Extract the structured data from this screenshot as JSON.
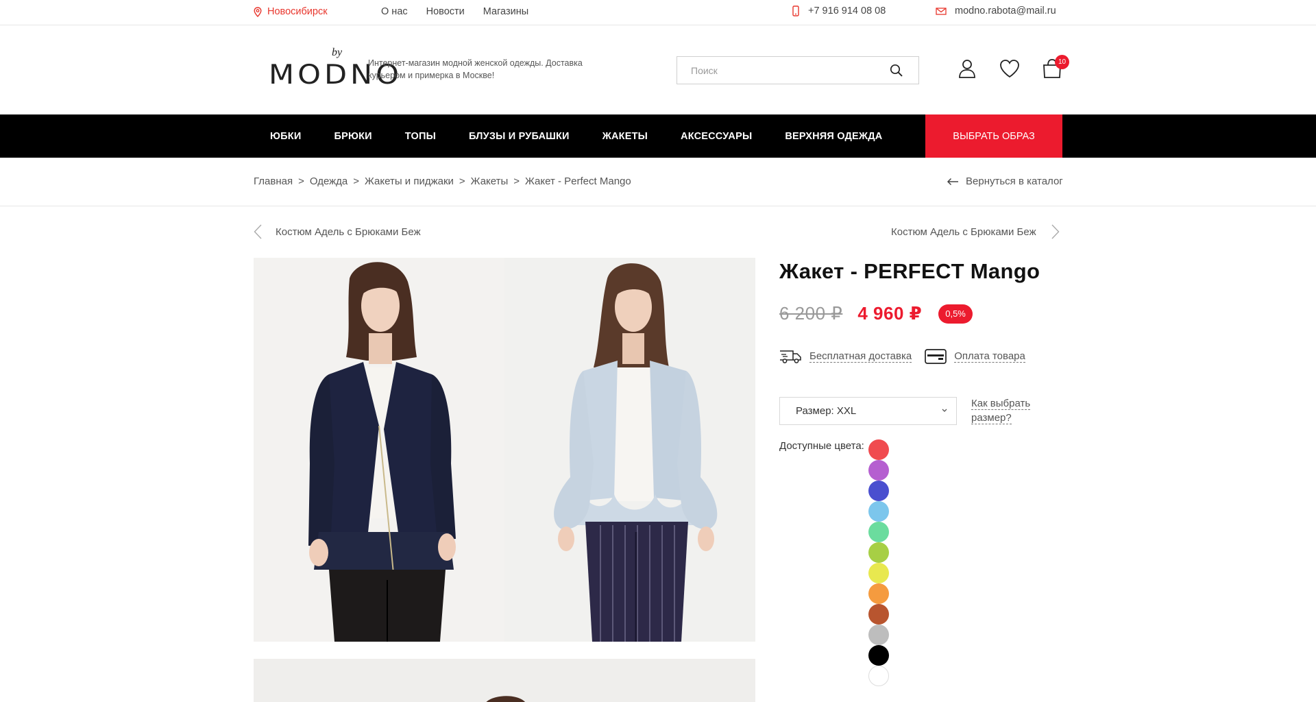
{
  "topbar": {
    "city": "Новосибирск",
    "links": [
      "О нас",
      "Новости",
      "Магазины"
    ],
    "phone": "+7 916 914 08 08",
    "email": "modno.rabota@mail.ru"
  },
  "header": {
    "logo_by": "by",
    "logo_word": "MODNO",
    "tagline": "Интернет-магазин модной женской одежды. Доставка курьером и примерка в Москве!",
    "search_placeholder": "Поиск",
    "cart_count": "10"
  },
  "menu": {
    "items": [
      "Юбки",
      "Брюки",
      "Топы",
      "Блузы и рубашки",
      "Жакеты",
      "Аксессуары",
      "Верхняя одежда"
    ],
    "cta": "Выбрать образ"
  },
  "breadcrumbs": [
    "Главная",
    "Одежда",
    "Жакеты и пиджаки",
    "Жакеты",
    "Жакет - Perfect Mango"
  ],
  "breadcrumb_sep": ">",
  "back_link": "Вернуться в каталог",
  "prev_product": "Костюм Адель с Брюками Беж",
  "next_product": "Костюм Адель с Брюками Беж",
  "product": {
    "title": "Жакет - PERFECT Mango",
    "old_price": "6 200 ₽",
    "new_price": "4 960 ₽",
    "discount": "0,5%",
    "feature_delivery": "Бесплатная доставка",
    "feature_payment": "Оплата товара",
    "size_label": "Размер: XXL",
    "size_help": "Как выбрать размер?",
    "colors_label": "Доступные цвета:",
    "colors": [
      "#f04b4f",
      "#b55fd0",
      "#4a4fcf",
      "#7cc6ec",
      "#6bdc9e",
      "#a7cf45",
      "#e8e84f",
      "#f59b3f",
      "#b8552f",
      "#bdbdbd",
      "#000000",
      "#ffffff"
    ]
  },
  "theme": {
    "accent": "#ec1b2e",
    "menu_bg": "#000000"
  }
}
